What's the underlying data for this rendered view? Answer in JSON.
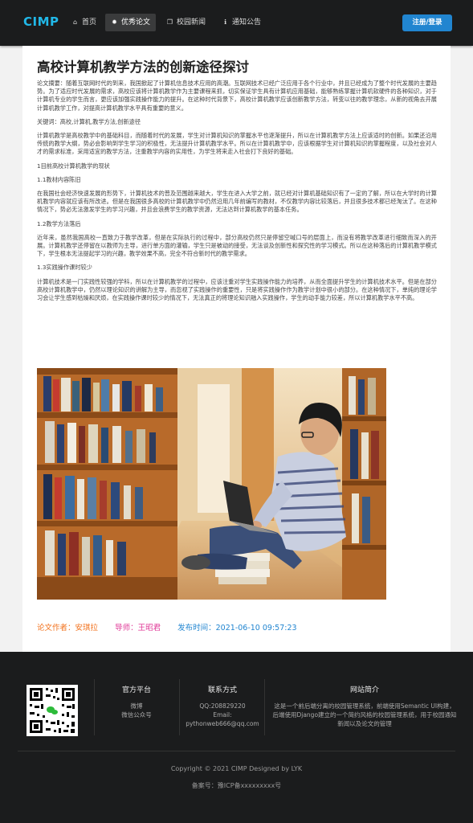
{
  "nav": {
    "brand": "CIMP",
    "items": [
      {
        "label": "首页",
        "icon": "home-icon",
        "glyph": "⌂"
      },
      {
        "label": "优秀论文",
        "icon": "lightbulb-icon",
        "glyph": "💡"
      },
      {
        "label": "校园新闻",
        "icon": "copy-icon",
        "glyph": "❐"
      },
      {
        "label": "通知公告",
        "icon": "info-icon",
        "glyph": "ℹ"
      }
    ],
    "active_index": 1,
    "login_label": "注册/登录"
  },
  "article": {
    "title": "高校计算机教学方法的创新途径探讨",
    "paragraphs": [
      "论文摘要：随着互联网时代的到来，我国掀起了计算机信息技术应用的高潮。互联网技术已经广泛应用于各个行业中，并且已经成为了整个时代发展的主要趋势。为了适应时代发展的需求，高校应该将计算机教学作为主要课程来抓，切实保证学生具有计算机应用基础，能够熟练掌握计算机软硬件的各种知识，对于计算机专业的学生而言，更应该加强实践操作能力的提升。在这种时代背景下，高校计算机教学应该创新教学方法，转变以往的教学理念，从新的视角去开展计算机教学工作，对提高计算机教学水平具有重要的意义。",
      "关键词：高校,计算机,教学方法,创新途径",
      "计算机教学是高校教学中的基础科目，而随着时代的发展，学生对计算机知识的掌握水平也逐渐提升，所以在计算机教学方法上应该适时的创新。如果还沿用传统的教学大纲，势必会影响到学生学习的积极性，无法提升计算机教学水平。所以在计算机教学中，应该根据学生对计算机知识的掌握程度，以及社会对人才的需求标准，采用适宜的教学方法，注重教学内容的实用性，为学生将来走入社会打下良好的基础。",
      "1目前高校计算机教学的现状",
      "1.1教材内容陈旧",
      "在我国社会经济快速发展的形势下，计算机技术的普及范围越来越大，学生在进入大学之前，就已经对计算机基础知识有了一定的了解，所以在大学时的计算机教学内容就应该有所改进。但是在我国很多高校的计算机教学中仍然沿用几年前编写的教材，不仅教学内容比较落后，并且很多技术都已经淘汰了。在这种情况下，势必无法激发学生的学习兴趣，并且会浪费学生的教学资源，无法达到计算机教学的基本任务。",
      "1.2教学方法落后",
      "近年来，虽然我国高校一直致力于教学改革，但是在实际执行的过程中，部分高校仍然只是停留空喊口号的层面上，而没有将教学改革进行细致而深入的开展。计算机教学还停留在以教师为主导，进行单方面的灌输，学生只是被动的接受，无法谈及创新性和探究性的学习模式。所以在这种落后的计算机教学模式下，学生根本无法提起学习的兴趣，教学效果不高，完全不符合新时代的教学需求。",
      "1.3实践操作课时较少",
      "计算机技术是一门实践性较强的学科，所以在计算机教学的过程中，应该注重对学生实践操作能力的培养，从而全面提升学生的计算机技术水平。但是在部分高校计算机教学中，仍然以理论知识的讲解为主导，而忽视了实践操作的重要性，只是将实践操作作为教学计划中很小的部分。在这种情况下，单纯的理论学习会让学生感到枯燥和厌烦，在实践操作课时较少的情况下，无法真正的将理论知识融入实践操作，学生的动手能力较差，所以计算机教学水平不高。"
    ],
    "meta": {
      "author_label": "论文作者：",
      "author": "安琪拉",
      "advisor_label": "导师：",
      "advisor": "王昭君",
      "time_label": "发布时间：",
      "time": "2021-06-10 09:57:23"
    }
  },
  "footer": {
    "platform_title": "官方平台",
    "platform_items": [
      "微博",
      "微信公众号"
    ],
    "contact_title": "联系方式",
    "contact_items": [
      "QQ:208829220",
      "Email:",
      "pythonweb666@qq.com"
    ],
    "about_title": "网站简介",
    "about_text": "这是一个前后端分离的校园管理系统，前端使用Semantic UI构建，后端使用Django建立的一个简约风格的校园管理系统，用于校园通知新闻以及论文的管理",
    "copyright": "Copyright © 2021 CIMP Designed by LYK",
    "icp": "备案号：豫ICP备xxxxxxxxx号"
  },
  "colors": {
    "brand": "#21b8e8",
    "primary_button": "#2185d0",
    "author": "#f2711c",
    "advisor": "#e03997",
    "time": "#2185d0",
    "nav_bg": "#1b1c1d"
  }
}
